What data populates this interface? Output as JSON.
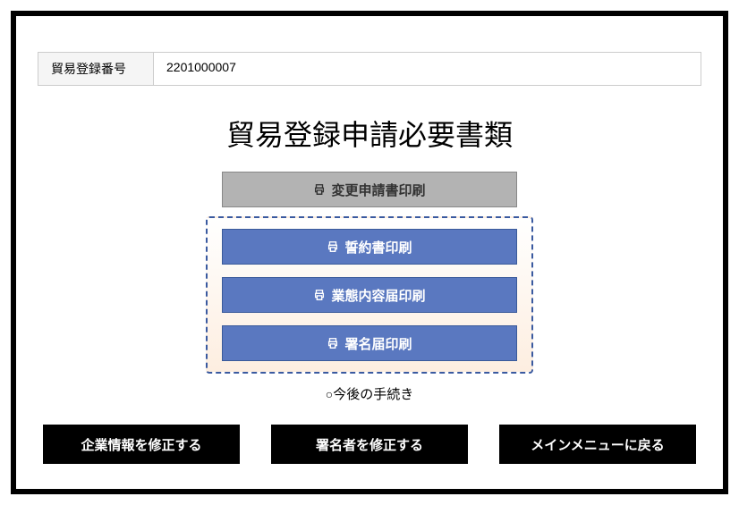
{
  "field": {
    "label": "貿易登録番号",
    "value": "2201000007"
  },
  "title": "貿易登録申請必要書類",
  "print_buttons": {
    "change_application": "変更申請書印刷",
    "pledge": "誓約書印刷",
    "business_report": "業態内容届印刷",
    "signature_report": "署名届印刷"
  },
  "footer_link": {
    "circle": "○",
    "text": "今後の手続き"
  },
  "bottom_buttons": {
    "edit_company": "企業情報を修正する",
    "edit_signer": "署名者を修正する",
    "main_menu": "メインメニューに戻る"
  }
}
